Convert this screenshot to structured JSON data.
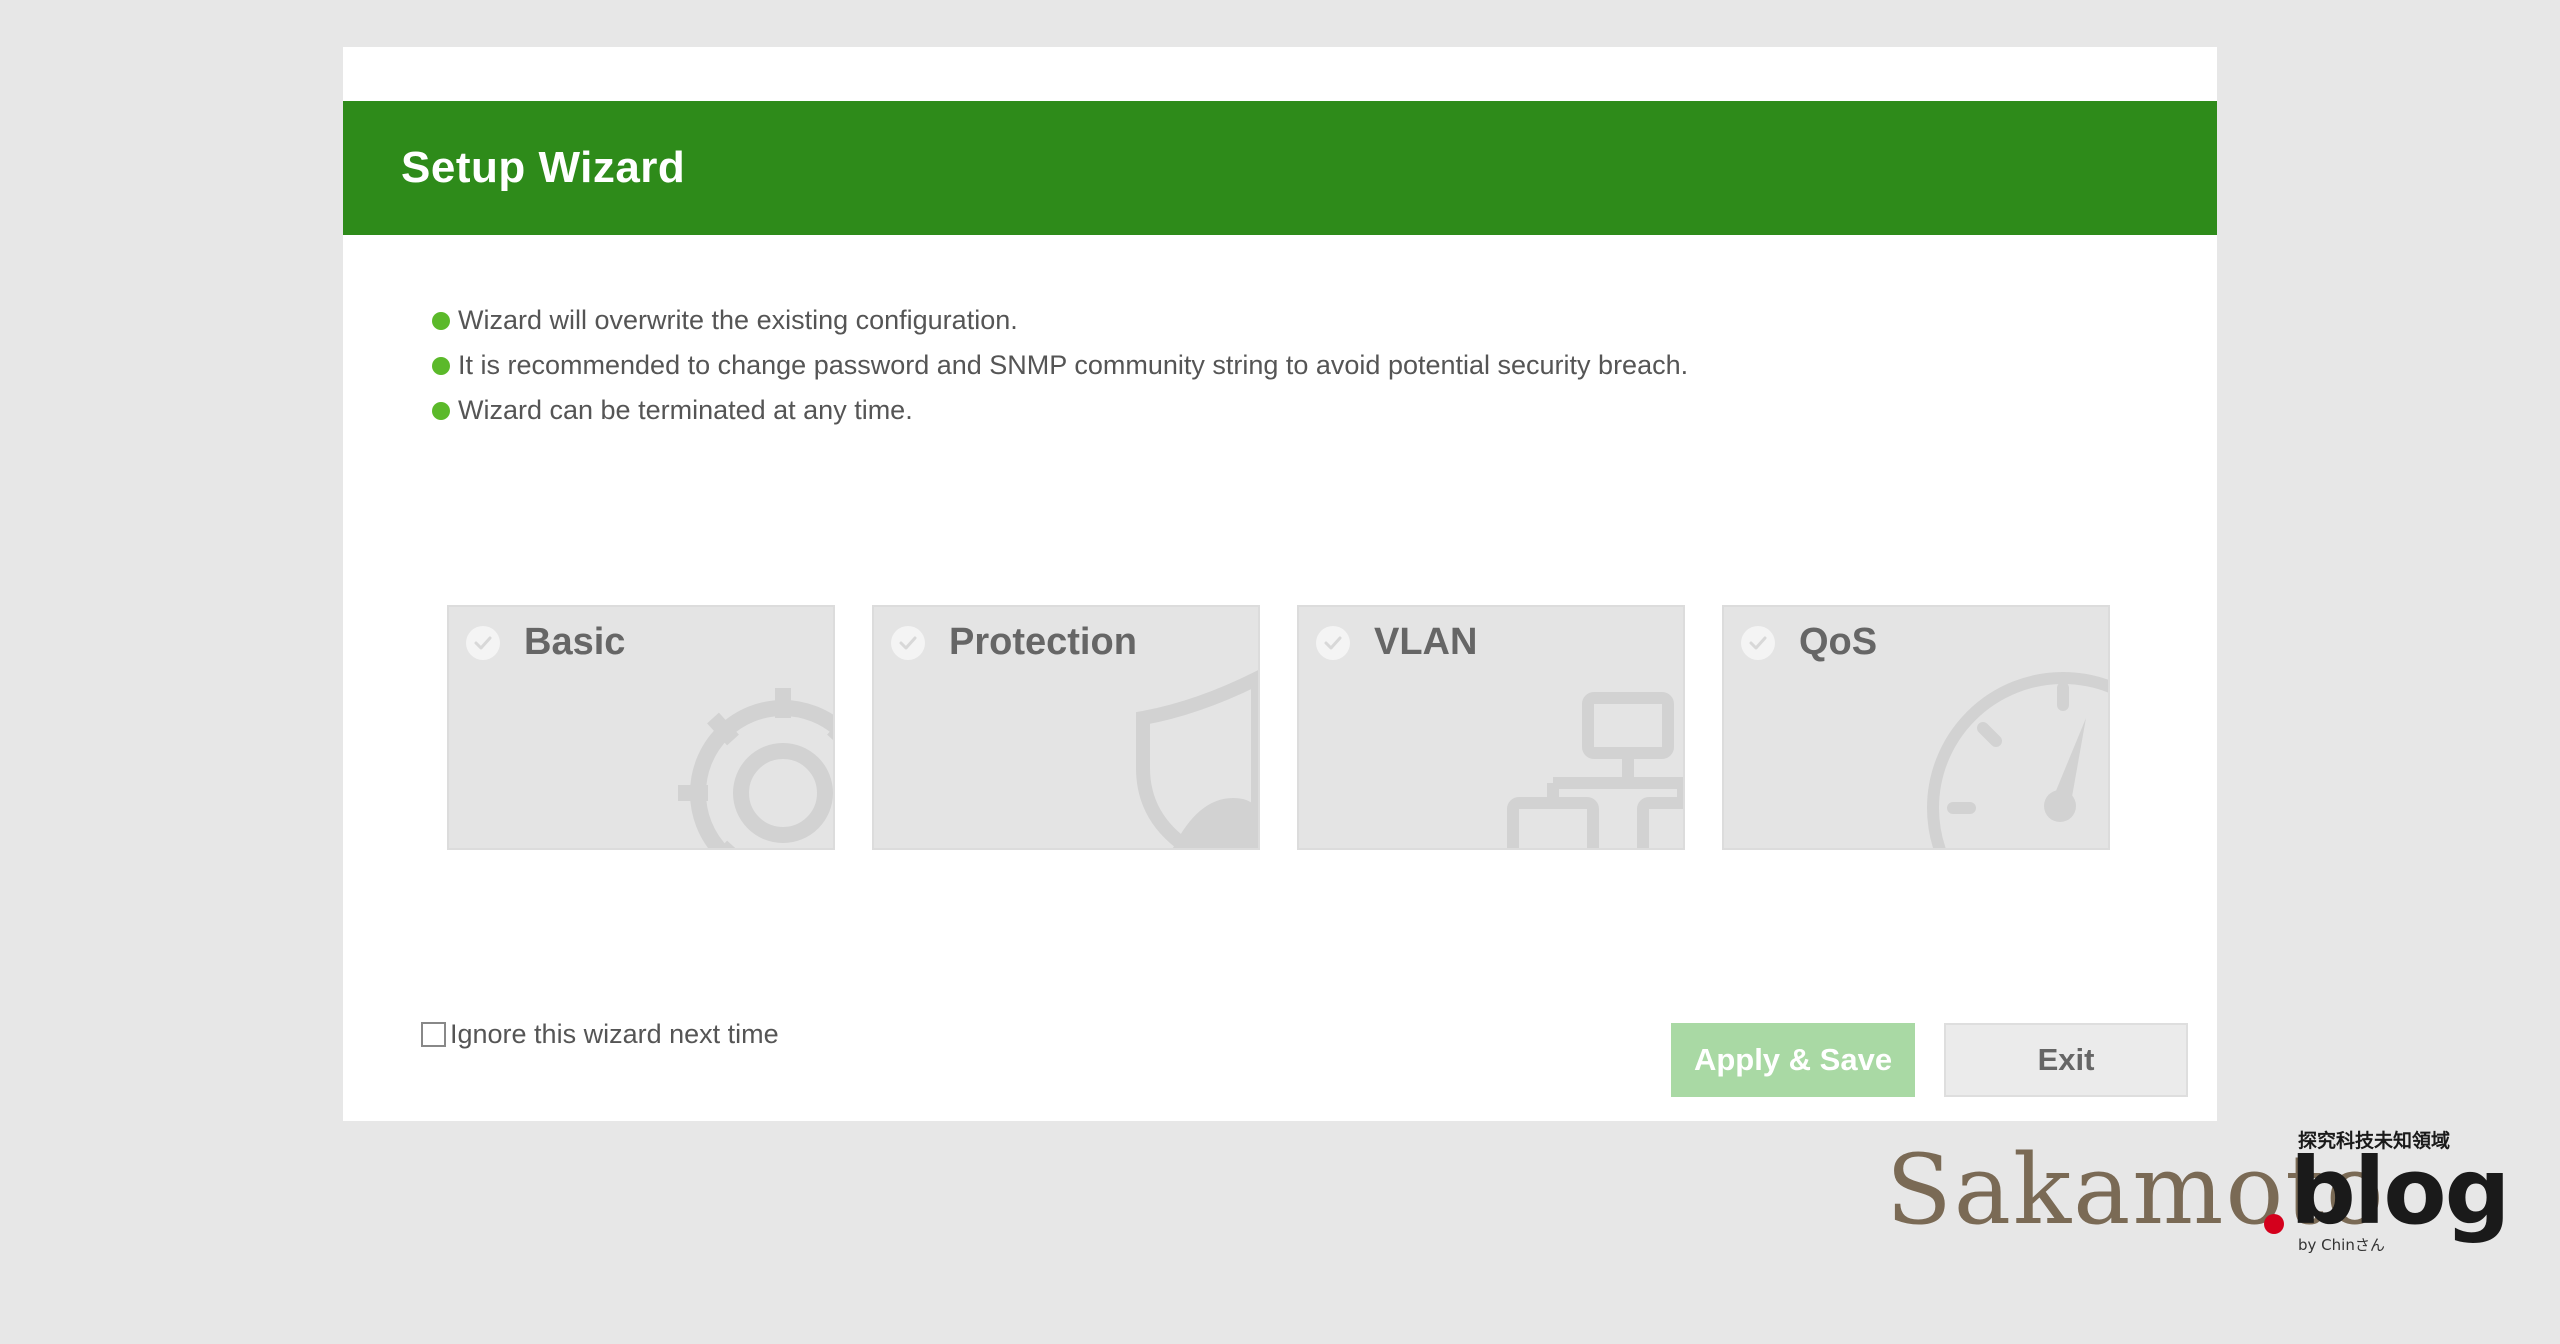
{
  "dialog": {
    "title": "Setup Wizard",
    "notes": [
      "Wizard will overwrite the existing configuration.",
      "It is recommended to change password and SNMP community string to avoid potential security breach.",
      "Wizard can be terminated at any time."
    ],
    "cards": [
      {
        "label": "Basic",
        "icon": "gear-icon"
      },
      {
        "label": "Protection",
        "icon": "shield-icon"
      },
      {
        "label": "VLAN",
        "icon": "network-topology-icon"
      },
      {
        "label": "QoS",
        "icon": "speedometer-icon"
      }
    ],
    "ignore_label": "Ignore this wizard next time",
    "ignore_checked": false,
    "apply_label": "Apply & Save",
    "exit_label": "Exit"
  },
  "watermark": {
    "script_text": "Sakamoto",
    "blog_text": "blog",
    "jp_text": "探究科技未知領域",
    "by_text": "by Chinさん"
  },
  "colors": {
    "header": "#2e8b1a",
    "bullet": "#5bb92a",
    "apply_button": "#a9d9a4",
    "card_bg": "#e4e4e4"
  }
}
